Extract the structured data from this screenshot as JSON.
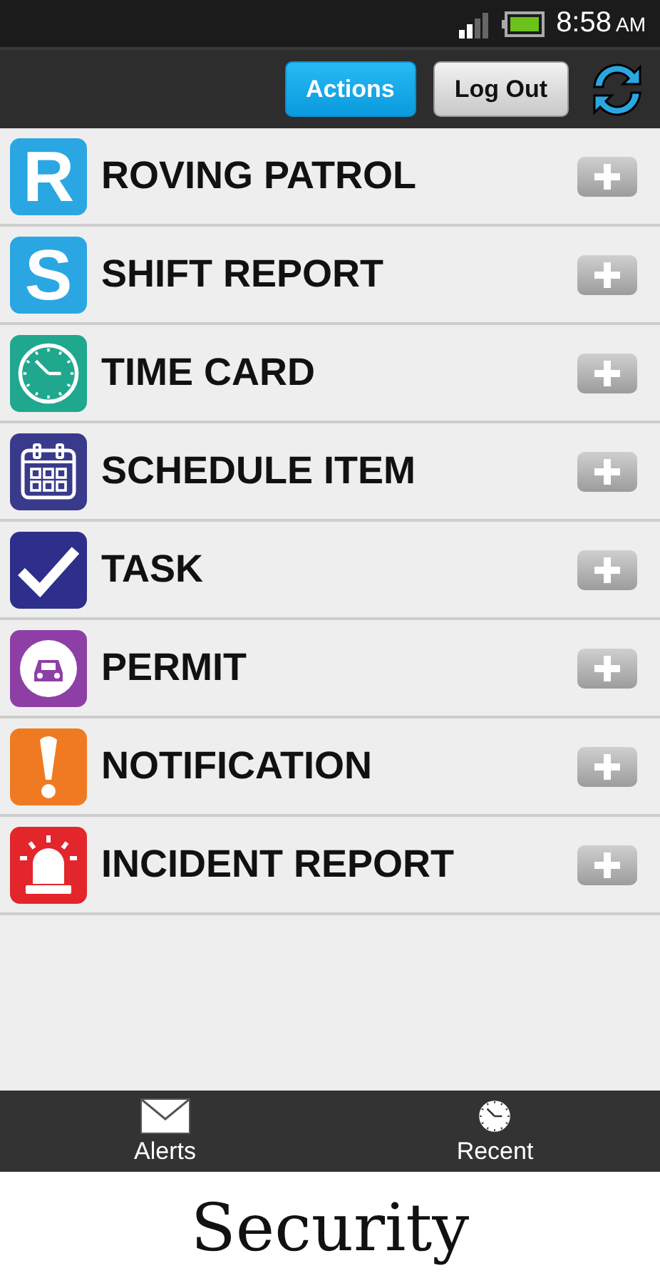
{
  "status_bar": {
    "time": "8:58",
    "meridiem": "AM"
  },
  "toolbar": {
    "buttons": [
      {
        "label": "Actions",
        "kind": "primary"
      },
      {
        "label": "Log Out",
        "kind": "secondary"
      }
    ]
  },
  "items": [
    {
      "label": "ROVING PATROL",
      "kind": "letter",
      "glyph": "R",
      "color": "#2aa7e3"
    },
    {
      "label": "SHIFT REPORT",
      "kind": "letter",
      "glyph": "S",
      "color": "#2aa7e3"
    },
    {
      "label": "TIME CARD",
      "kind": "clock",
      "color": "#1fa88e"
    },
    {
      "label": "SCHEDULE ITEM",
      "kind": "calendar",
      "color": "#3a3a8c"
    },
    {
      "label": "TASK",
      "kind": "check",
      "color": "#2e2f8a"
    },
    {
      "label": "PERMIT",
      "kind": "car",
      "color": "#8e3fa6"
    },
    {
      "label": "NOTIFICATION",
      "kind": "alert",
      "color": "#f07a22"
    },
    {
      "label": "INCIDENT REPORT",
      "kind": "siren",
      "color": "#e3262b"
    }
  ],
  "bottom_nav": [
    {
      "label": "Alerts",
      "kind": "mail"
    },
    {
      "label": "Recent",
      "kind": "clock"
    }
  ],
  "caption": "Security"
}
